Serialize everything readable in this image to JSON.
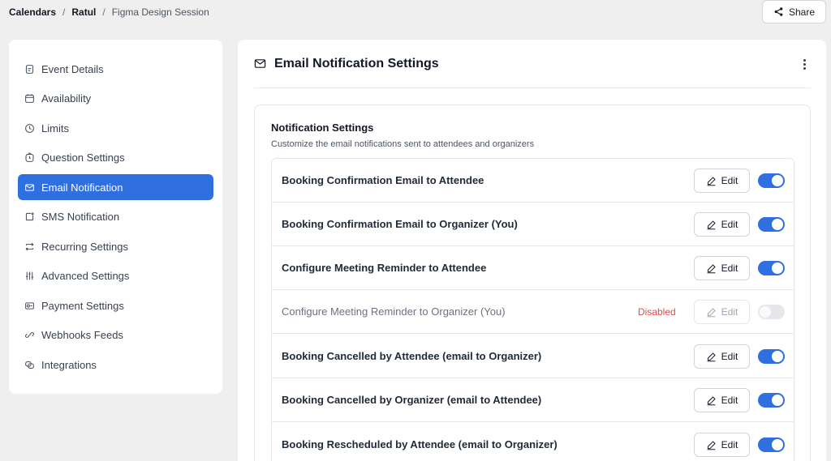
{
  "breadcrumb": {
    "item1": "Calendars",
    "sep": "/",
    "item2": "Ratul",
    "item3": "Figma Design Session"
  },
  "share_label": "Share",
  "sidebar": {
    "items": [
      {
        "label": "Event Details",
        "icon": "document-icon"
      },
      {
        "label": "Availability",
        "icon": "calendar-icon"
      },
      {
        "label": "Limits",
        "icon": "clock-icon"
      },
      {
        "label": "Question Settings",
        "icon": "timer-icon"
      },
      {
        "label": "Email Notification",
        "icon": "mail-icon",
        "active": true
      },
      {
        "label": "SMS Notification",
        "icon": "sms-icon"
      },
      {
        "label": "Recurring Settings",
        "icon": "repeat-icon"
      },
      {
        "label": "Advanced Settings",
        "icon": "sliders-icon"
      },
      {
        "label": "Payment Settings",
        "icon": "payment-icon"
      },
      {
        "label": "Webhooks Feeds",
        "icon": "link-icon"
      },
      {
        "label": "Integrations",
        "icon": "integrations-icon"
      }
    ]
  },
  "main": {
    "title": "Email Notification Settings"
  },
  "card": {
    "title": "Notification Settings",
    "subtitle": "Customize the email notifications sent to attendees and organizers"
  },
  "notifications": [
    {
      "label": "Booking Confirmation Email to Attendee",
      "enabled": true,
      "edit_label": "Edit"
    },
    {
      "label": "Booking Confirmation Email to Organizer (You)",
      "enabled": true,
      "edit_label": "Edit"
    },
    {
      "label": "Configure Meeting Reminder to Attendee",
      "enabled": true,
      "edit_label": "Edit"
    },
    {
      "label": "Configure Meeting Reminder to Organizer (You)",
      "enabled": false,
      "status": "Disabled",
      "edit_label": "Edit"
    },
    {
      "label": "Booking Cancelled by Attendee (email to Organizer)",
      "enabled": true,
      "edit_label": "Edit"
    },
    {
      "label": "Booking Cancelled by Organizer (email to Attendee)",
      "enabled": true,
      "edit_label": "Edit"
    },
    {
      "label": "Booking Rescheduled by Attendee (email to Organizer)",
      "enabled": true,
      "edit_label": "Edit"
    }
  ],
  "colors": {
    "accent": "#2f6fe0",
    "disabled_text": "#ef4444"
  }
}
